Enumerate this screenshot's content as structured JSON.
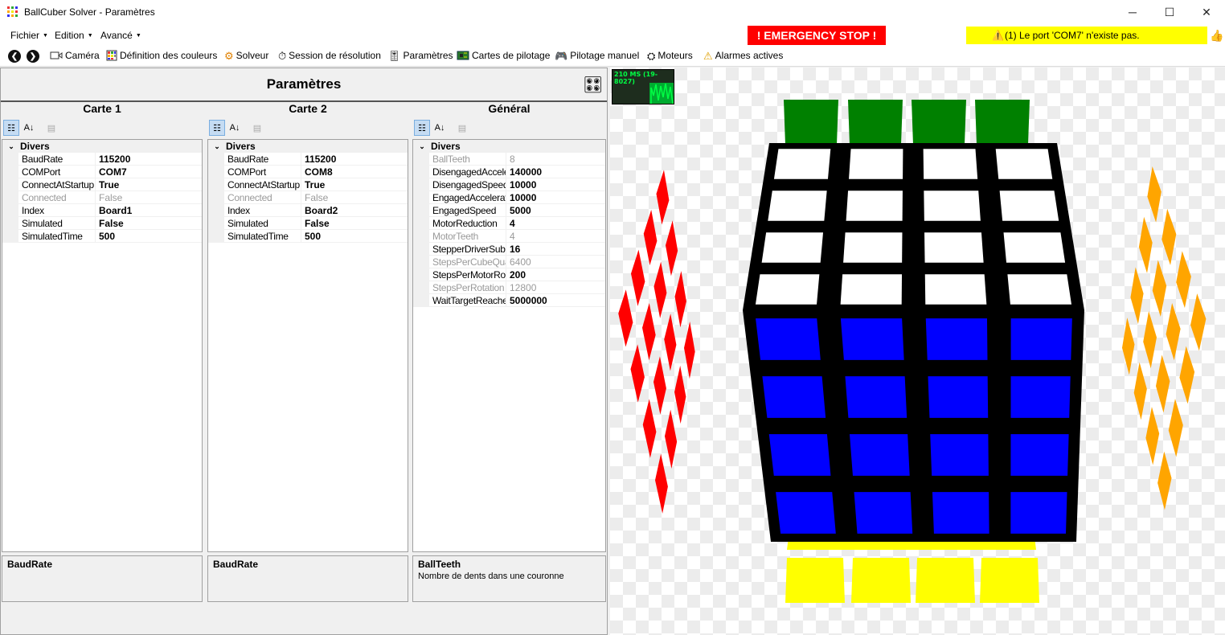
{
  "window": {
    "title": "BallCuber Solver - Paramètres",
    "minimize": "─",
    "maximize": "☐",
    "close": "✕"
  },
  "menu": {
    "items": [
      "Fichier",
      "Edition",
      "Avancé"
    ]
  },
  "emergency": {
    "label": "! EMERGENCY STOP !",
    "color": "#ff0000"
  },
  "alarm": {
    "text": "(1) Le port 'COM7' n'existe pas.",
    "color": "#ffff00"
  },
  "toolbar": {
    "items": [
      {
        "label": "Caméra",
        "icon": "camera-icon"
      },
      {
        "label": "Définition des couleurs",
        "icon": "palette-icon"
      },
      {
        "label": "Solveur",
        "icon": "gears-icon"
      },
      {
        "label": "Session de résolution",
        "icon": "stopwatch-icon"
      },
      {
        "label": "Paramètres",
        "icon": "sliders-icon"
      },
      {
        "label": "Cartes de pilotage",
        "icon": "circuit-board-icon"
      },
      {
        "label": "Pilotage manuel",
        "icon": "manual-control-icon"
      },
      {
        "label": "Moteurs",
        "icon": "motor-icon"
      },
      {
        "label": "Alarmes actives",
        "icon": "warning-icon"
      }
    ]
  },
  "params": {
    "title": "Paramètres",
    "cards": [
      {
        "title": "Carte 1",
        "category": "Divers",
        "rows": [
          {
            "name": "BaudRate",
            "value": "115200",
            "readonly": false
          },
          {
            "name": "COMPort",
            "value": "COM7",
            "readonly": false
          },
          {
            "name": "ConnectAtStartup",
            "value": "True",
            "readonly": false
          },
          {
            "name": "Connected",
            "value": "False",
            "readonly": true
          },
          {
            "name": "Index",
            "value": "Board1",
            "readonly": false
          },
          {
            "name": "Simulated",
            "value": "False",
            "readonly": false
          },
          {
            "name": "SimulatedTime",
            "value": "500",
            "readonly": false
          }
        ],
        "help_title": "BaudRate",
        "help_desc": ""
      },
      {
        "title": "Carte 2",
        "category": "Divers",
        "rows": [
          {
            "name": "BaudRate",
            "value": "115200",
            "readonly": false
          },
          {
            "name": "COMPort",
            "value": "COM8",
            "readonly": false
          },
          {
            "name": "ConnectAtStartup",
            "value": "True",
            "readonly": false
          },
          {
            "name": "Connected",
            "value": "False",
            "readonly": true
          },
          {
            "name": "Index",
            "value": "Board2",
            "readonly": false
          },
          {
            "name": "Simulated",
            "value": "False",
            "readonly": false
          },
          {
            "name": "SimulatedTime",
            "value": "500",
            "readonly": false
          }
        ],
        "help_title": "BaudRate",
        "help_desc": ""
      },
      {
        "title": "Général",
        "category": "Divers",
        "rows": [
          {
            "name": "BallTeeth",
            "value": "8",
            "readonly": true
          },
          {
            "name": "DisengagedAccele",
            "value": "140000",
            "readonly": false
          },
          {
            "name": "DisengagedSpeed",
            "value": "10000",
            "readonly": false
          },
          {
            "name": "EngagedAcceleratio",
            "value": "10000",
            "readonly": false
          },
          {
            "name": "EngagedSpeed",
            "value": "5000",
            "readonly": false
          },
          {
            "name": "MotorReduction",
            "value": "4",
            "readonly": false
          },
          {
            "name": "MotorTeeth",
            "value": "4",
            "readonly": true
          },
          {
            "name": "StepperDriverSubS",
            "value": "16",
            "readonly": false
          },
          {
            "name": "StepsPerCubeQuar",
            "value": "6400",
            "readonly": true
          },
          {
            "name": "StepsPerMotorRota",
            "value": "200",
            "readonly": false
          },
          {
            "name": "StepsPerRotation",
            "value": "12800",
            "readonly": true
          },
          {
            "name": "WaitTargetReache",
            "value": "5000000",
            "readonly": false
          }
        ],
        "help_title": "BallTeeth",
        "help_desc": "Nombre de dents dans une couronne"
      }
    ]
  },
  "viewport": {
    "perf_label": "210 MS (19-8027)",
    "cube_colors": {
      "top": "#ffffff",
      "front": "#0000ff",
      "left": "#ff0000",
      "right": "#ffa500",
      "back": "#008000",
      "bottom": "#ffff00",
      "edges": "#000000"
    }
  }
}
